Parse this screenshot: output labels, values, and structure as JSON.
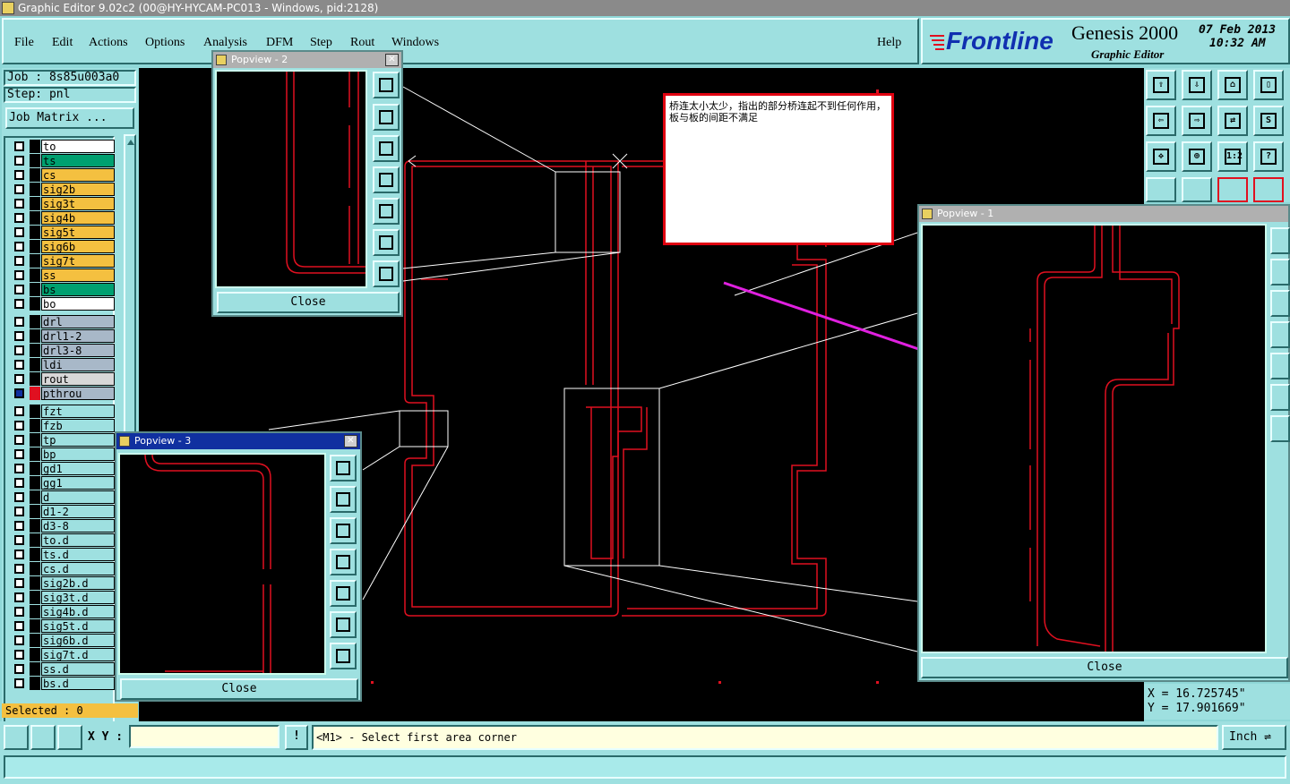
{
  "window": {
    "title": "Graphic Editor 9.02c2 (00@HY-HYCAM-PC013 - Windows, pid:2128)"
  },
  "menu": {
    "items": [
      "File",
      "Edit",
      "Actions",
      "Options",
      "Analysis",
      "DFM",
      "Step",
      "Rout",
      "Windows"
    ],
    "help": "Help"
  },
  "brand": {
    "logo": "Frontline",
    "product": "Genesis 2000",
    "subtitle": "Graphic Editor",
    "date": "07 Feb 2013",
    "time": "10:32 AM"
  },
  "job": {
    "job_label": "Job : 8s85u003a0",
    "step_label": "Step: pnl",
    "matrix_button": "Job Matrix ..."
  },
  "layers_group1": [
    {
      "name": "to",
      "color": "#ffffff"
    },
    {
      "name": "ts",
      "color": "#00a070"
    },
    {
      "name": "cs",
      "color": "#f4c040"
    },
    {
      "name": "sig2b",
      "color": "#f4c040"
    },
    {
      "name": "sig3t",
      "color": "#f4c040"
    },
    {
      "name": "sig4b",
      "color": "#f4c040"
    },
    {
      "name": "sig5t",
      "color": "#f4c040"
    },
    {
      "name": "sig6b",
      "color": "#f4c040"
    },
    {
      "name": "sig7t",
      "color": "#f4c040"
    },
    {
      "name": "ss",
      "color": "#f4c040"
    },
    {
      "name": "bs",
      "color": "#00a070"
    },
    {
      "name": "bo",
      "color": "#ffffff"
    }
  ],
  "layers_group2": [
    {
      "name": "drl",
      "color": "#a8b8c8"
    },
    {
      "name": "drl1-2",
      "color": "#a8b8c8"
    },
    {
      "name": "drl3-8",
      "color": "#a8b8c8"
    },
    {
      "name": "ldi",
      "color": "#a8b8c8"
    },
    {
      "name": "rout",
      "color": "#d8d8d8"
    },
    {
      "name": "pthrou",
      "color": "#a8b8c8"
    }
  ],
  "layers_group3": [
    {
      "name": "fzt"
    },
    {
      "name": "fzb"
    },
    {
      "name": "tp"
    },
    {
      "name": "bp"
    },
    {
      "name": "gd1"
    },
    {
      "name": "gg1"
    },
    {
      "name": "d"
    },
    {
      "name": "d1-2"
    },
    {
      "name": "d3-8"
    },
    {
      "name": "to.d"
    },
    {
      "name": "ts.d"
    },
    {
      "name": "cs.d"
    },
    {
      "name": "sig2b.d"
    },
    {
      "name": "sig3t.d"
    },
    {
      "name": "sig4b.d"
    },
    {
      "name": "sig5t.d"
    },
    {
      "name": "sig6b.d"
    },
    {
      "name": "sig7t.d"
    },
    {
      "name": "ss.d"
    },
    {
      "name": "bs.d"
    }
  ],
  "selected": "Selected : 0",
  "popviews": {
    "p1": "Popview - 1",
    "p2": "Popview - 2",
    "p3": "Popview - 3",
    "close": "Close"
  },
  "note": {
    "text": "桥连太小太少，指出的部分桥连起不到任何作用，板与板的间距不满足"
  },
  "coords": {
    "x": "X  =  16.725745\"",
    "y": "Y  =  17.901669\""
  },
  "command": {
    "xy_label": "X Y :",
    "xy_value": "",
    "prompt": "<M1> - Select first area corner",
    "units": "Inch"
  },
  "toolbar_icons": [
    "zoom-home-icon",
    "zoom-down-icon",
    "home-icon",
    "window-icon",
    "pan-left-icon",
    "pan-right-icon",
    "swap-icon",
    "s-icon",
    "fit-icon",
    "center-icon",
    "scale-1-2-icon",
    "help-icon"
  ],
  "colors": {
    "panel": "#9ee0e0",
    "canvas": "#000000",
    "trace": "#e01020",
    "arrow": "#e020e0"
  }
}
